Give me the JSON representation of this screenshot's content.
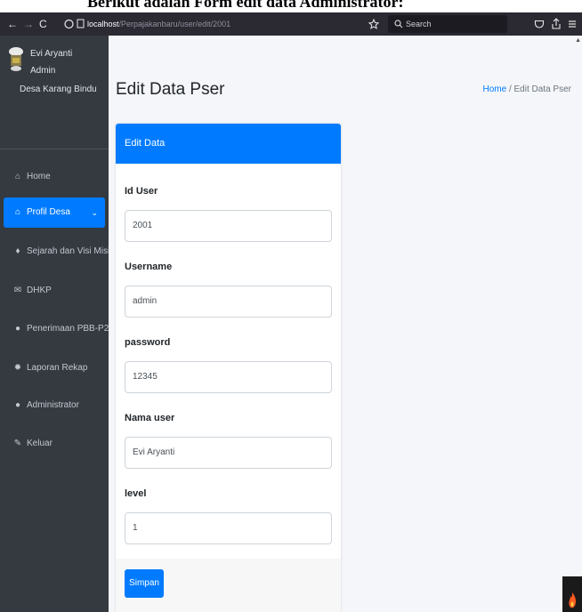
{
  "caption": "Berikut adalah Form edit data Administrator:",
  "browser": {
    "back": "←",
    "forward": "→",
    "reload": "C",
    "url_host": "localhost",
    "url_path": "/Perpajakanbaru/user/edit/2001",
    "search_placeholder": "Search"
  },
  "sidebar": {
    "user_name": "Evi Aryanti",
    "user_role": "Admin",
    "user_place": "Desa Karang Bindu",
    "items": [
      {
        "label": "Home",
        "icon": "home-icon"
      },
      {
        "label": "Profil Desa",
        "icon": "home-icon",
        "active": true
      },
      {
        "label": "Sejarah dan Visi Misi",
        "icon": "pin-icon"
      },
      {
        "label": "DHKP",
        "icon": "envelope-icon"
      },
      {
        "label": "Penerimaan PBB-P2",
        "icon": "user-icon"
      },
      {
        "label": "Laporan Rekap",
        "icon": "gear-icon"
      },
      {
        "label": "Administrator",
        "icon": "user-icon"
      },
      {
        "label": "Keluar",
        "icon": "brush-icon"
      }
    ]
  },
  "page": {
    "title": "Edit Data Pser",
    "breadcrumb_home": "Home",
    "breadcrumb_sep": "/",
    "breadcrumb_current": "Edit Data Pser"
  },
  "form": {
    "header": "Edit Data",
    "id_label": "Id User",
    "id_value": "2001",
    "username_label": "Username",
    "username_value": "admin",
    "password_label": "password",
    "password_value": "12345",
    "nama_label": "Nama user",
    "nama_value": "Evi Aryanti",
    "level_label": "level",
    "level_value": "1",
    "submit": "Simpan"
  },
  "colors": {
    "sidebar_bg": "#343a40",
    "primary": "#007bff",
    "content_bg": "#f4f6f9",
    "browser_bg": "#2b2a33"
  }
}
